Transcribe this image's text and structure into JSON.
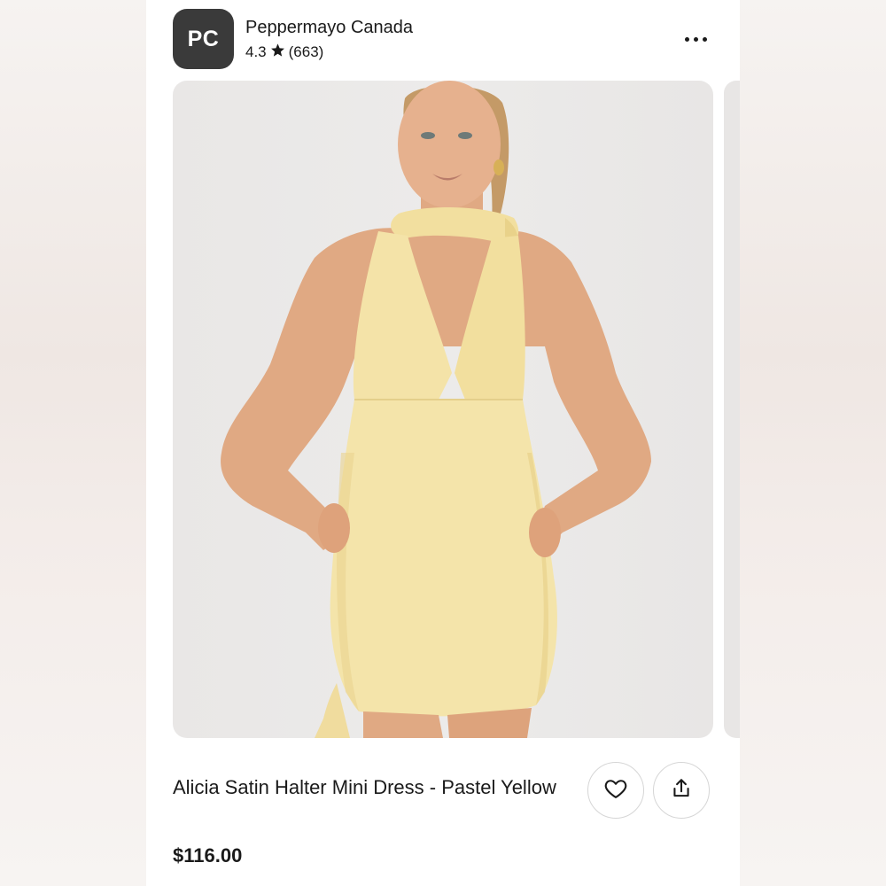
{
  "store": {
    "avatar_initials": "PC",
    "name": "Peppermayo Canada",
    "rating": "4.3",
    "review_count": "(663)"
  },
  "product": {
    "title": "Alicia Satin Halter Mini Dress - Pastel Yellow",
    "price": "$116.00",
    "image_description_colors": {
      "background": "#eae8e7",
      "dress": "#f3e2a6",
      "skin": "#e2ab86",
      "hair": "#c49a67"
    }
  },
  "icons": {
    "more": "more-horizontal-icon",
    "star": "star-icon",
    "favorite": "heart-icon",
    "share": "share-icon"
  }
}
